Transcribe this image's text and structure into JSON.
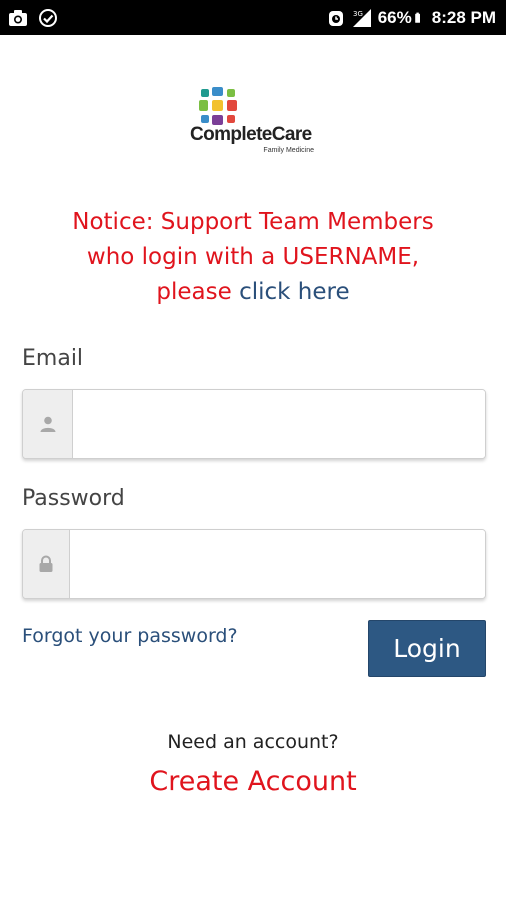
{
  "status_bar": {
    "left_icons": [
      "camera-icon",
      "check-circle-icon"
    ],
    "right_icons": [
      "alarm-icon",
      "signal-icon",
      "battery-icon"
    ],
    "battery": "66%",
    "time": "8:28 PM"
  },
  "logo": {
    "name": "CompleteCare",
    "tagline": "Family Medicine",
    "colors": [
      "#3a8dc9",
      "#7bbf43",
      "#f2c12e",
      "#e2483d",
      "#7b3f97",
      "#1f9a8f"
    ]
  },
  "notice": {
    "line1": "Notice: Support Team Members",
    "line2": "who login with a USERNAME,",
    "line3_prefix": "please",
    "link_text": "click here"
  },
  "form": {
    "email_label": "Email",
    "email_icon": "user-icon",
    "email_value": "",
    "password_label": "Password",
    "password_icon": "lock-icon",
    "password_value": "",
    "forgot_password": "Forgot your password?",
    "login_button": "Login"
  },
  "account": {
    "prompt": "Need an account?",
    "create_link": "Create Account"
  },
  "colors": {
    "notice_red": "#e0141d",
    "link_blue": "#2a4f7a",
    "button_blue": "#2d5883"
  }
}
